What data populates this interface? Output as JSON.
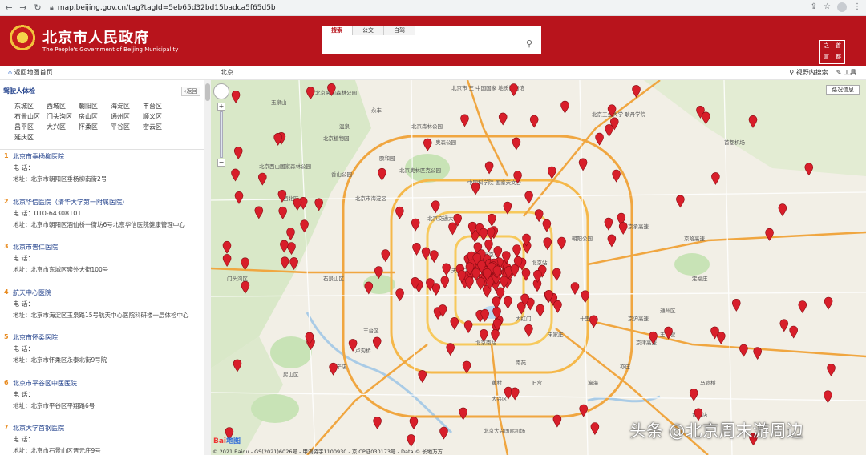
{
  "browser": {
    "url": "map.beijing.gov.cn/tag?tagId=5eb65d32bd15badca5f65d5b"
  },
  "header": {
    "title": "北京市人民政府",
    "subtitle": "The People's Government of Beijing Municipality",
    "search_tabs": [
      "搜索",
      "公交",
      "自驾"
    ],
    "right_logo": [
      "之",
      "首",
      "言",
      "都"
    ]
  },
  "toolbar": {
    "back_home": "返回地图首页",
    "region": "北京",
    "visible_search": "视野内搜索",
    "tools": "工具"
  },
  "panel": {
    "heading": "驾驶人体检",
    "return_label": "返回",
    "districts": [
      "东城区",
      "西城区",
      "朝阳区",
      "海淀区",
      "丰台区",
      "石景山区",
      "门头沟区",
      "房山区",
      "通州区",
      "顺义区",
      "昌平区",
      "大兴区",
      "怀柔区",
      "平谷区",
      "密云区",
      "延庆区"
    ],
    "results": [
      {
        "num": "1",
        "name": "北京市垂杨柳医院",
        "phone": "电 话：",
        "addr": "地址：北京市朝阳区垂杨柳南街2号"
      },
      {
        "num": "2",
        "name": "北京华信医院（清华大学第一附属医院）",
        "phone": "电 话：010-64308101",
        "addr": "地址：北京市朝阳区酒仙桥一街坊6号北京华信医院健康管理中心"
      },
      {
        "num": "3",
        "name": "北京市普仁医院",
        "phone": "电 话：",
        "addr": "地址：北京市东城区崇外大街100号"
      },
      {
        "num": "4",
        "name": "航天中心医院",
        "phone": "电 话：",
        "addr": "地址：北京市海淀区玉泉路15号航天中心医院科研楼一层体检中心"
      },
      {
        "num": "5",
        "name": "北京市怀柔医院",
        "phone": "电 话：",
        "addr": "地址：北京市怀柔区永泰北街9号院"
      },
      {
        "num": "6",
        "name": "北京市平谷区中医医院",
        "phone": "电 话：",
        "addr": "地址：北京市平谷区平翔路6号"
      },
      {
        "num": "7",
        "name": "北京大学首钢医院",
        "phone": "电 话：",
        "addr": "地址：北京市石景山区晋元庄9号"
      }
    ]
  },
  "map": {
    "traffic_button": "路况信息",
    "labels": [
      "北京市 三 中国国家 地质博物馆",
      "北京奥林匹克公园",
      "北京工业大学 耿丹学院",
      "中国科学院 国家天文台",
      "北京高山森林公园",
      "玉泉山",
      "北京植物园",
      "北京西山国家森林公园",
      "北京市海淀区",
      "北京交通大学",
      "北京市",
      "天安门广场",
      "北京站",
      "北京南站",
      "北京大兴国际机场",
      "丰台区",
      "通州区",
      "亦庄",
      "大兴区",
      "房山区",
      "京承高速",
      "京哈高速",
      "京沪高速",
      "京津高速",
      "首都机场",
      "石景山区",
      "门头沟区",
      "卢沟桥",
      "南苑",
      "朝阳公园",
      "奥森公园",
      "颐和园",
      "香山公园",
      "温泉",
      "北京森林公园",
      "定福庄",
      "宋家庄",
      "十里河",
      "大红门",
      "王四营",
      "长辛店",
      "永丰",
      "西北旺",
      "马驹桥",
      "青云店",
      "旧宫",
      "瀛海",
      "黄村"
    ],
    "copyright": "© 2021 Baidu - GS(2021)6026号 - 甲测资字1100930 - 京ICP证030173号 - Data © 长地万方",
    "baidu_logo_a": "Bai",
    "baidu_logo_b": "地图"
  },
  "watermark": "头条 @北京周末游周边",
  "colors": {
    "header_red": "#b8141c",
    "marker_red": "#d81e2a",
    "link_blue": "#1e3e8a",
    "number_orange": "#e88b20"
  }
}
